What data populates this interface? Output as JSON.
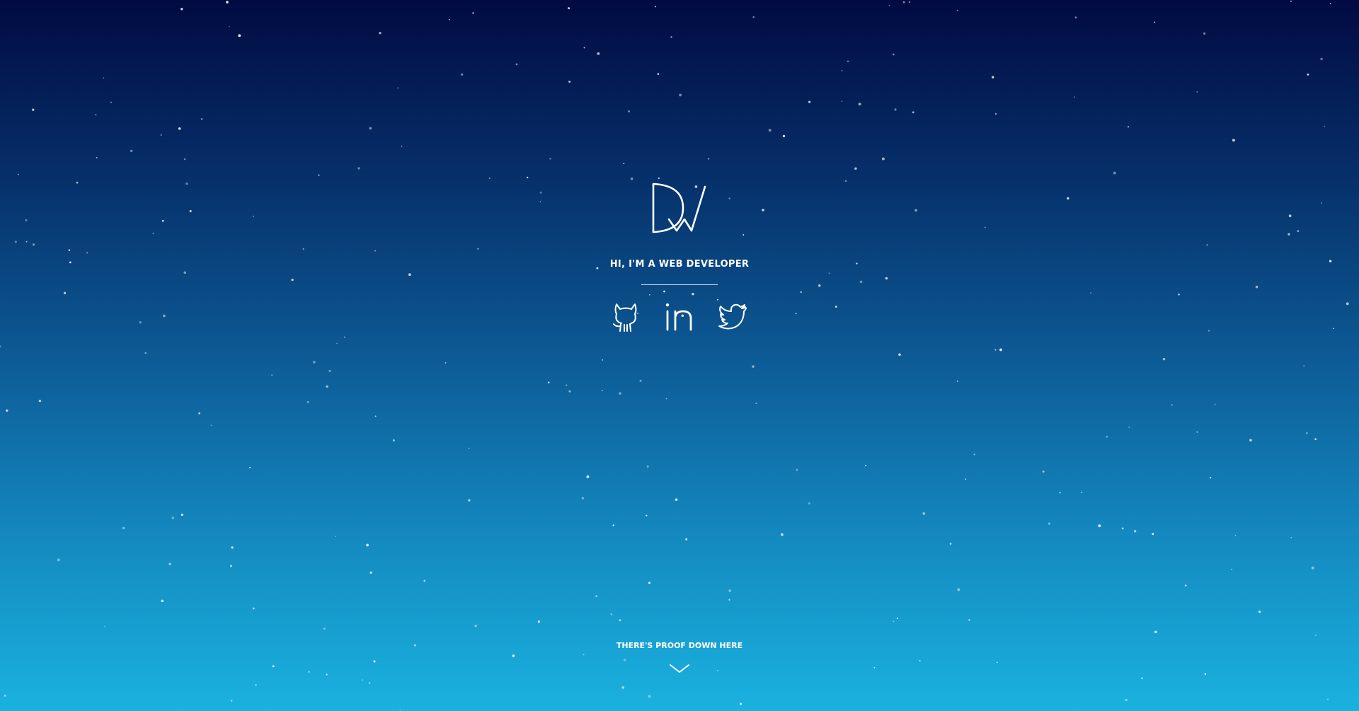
{
  "hero": {
    "background_top": "#020a42",
    "background_bottom": "#1ab2df",
    "logo_icon": "dw-monogram-logo",
    "tagline": "HI, I'M A WEB DEVELOPER",
    "social_links": [
      {
        "name": "github",
        "icon": "github-icon"
      },
      {
        "name": "linkedin",
        "icon": "linkedin-icon"
      },
      {
        "name": "twitter",
        "icon": "twitter-icon"
      }
    ],
    "scroll_hint": "THERE'S PROOF DOWN HERE",
    "scroll_icon": "chevron-down-icon"
  }
}
